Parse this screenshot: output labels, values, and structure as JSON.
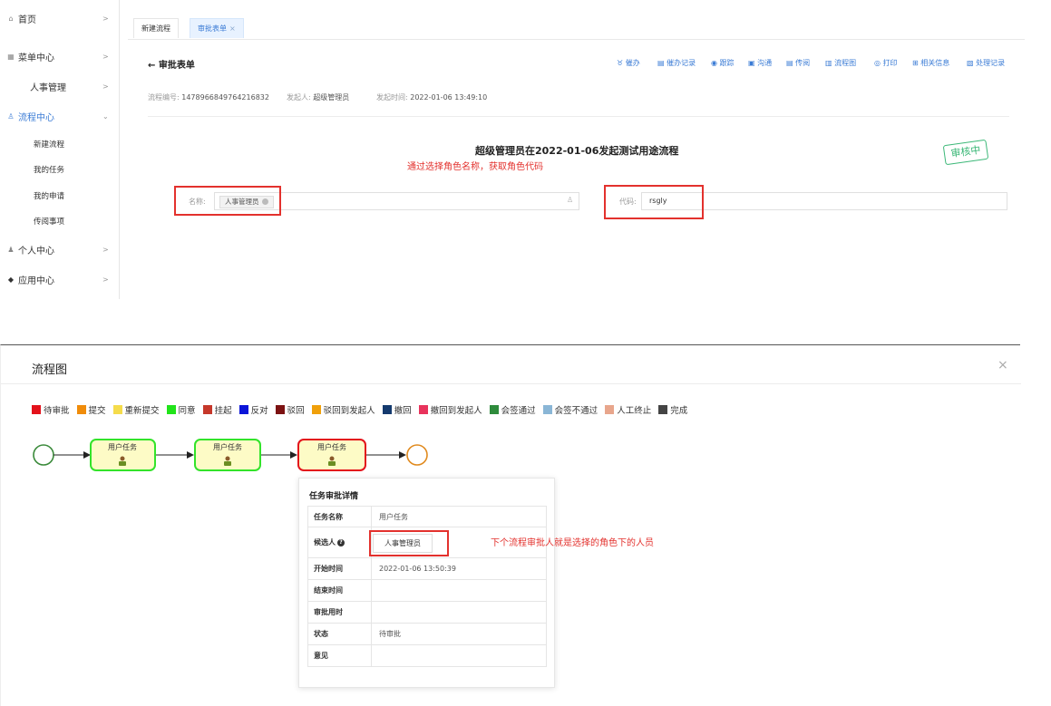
{
  "sidebar": {
    "items": [
      {
        "icon": "home-icon",
        "label": "首页"
      },
      {
        "icon": "grid-icon",
        "label": "菜单中心"
      },
      {
        "label": "人事管理"
      },
      {
        "icon": "flow-icon",
        "label": "流程中心"
      },
      {
        "label": "新建流程"
      },
      {
        "label": "我的任务"
      },
      {
        "label": "我的申请"
      },
      {
        "label": "传阅事项"
      },
      {
        "icon": "user-icon",
        "label": "个人中心"
      },
      {
        "icon": "app-icon",
        "label": "应用中心"
      }
    ],
    "arrow": ">",
    "arrow_down": "⌄"
  },
  "tabs": [
    {
      "label": "新建流程"
    },
    {
      "label": "审批表单",
      "close": "×"
    }
  ],
  "header": {
    "back": "←",
    "title": "审批表单"
  },
  "toolbar": [
    {
      "icon": "urge-icon",
      "label": "催办"
    },
    {
      "icon": "urge-record-icon",
      "label": "催办记录"
    },
    {
      "icon": "track-icon",
      "label": "跟踪"
    },
    {
      "icon": "chat-icon",
      "label": "沟通"
    },
    {
      "icon": "circulate-icon",
      "label": "传阅"
    },
    {
      "icon": "flowchart-icon",
      "label": "流程图"
    },
    {
      "icon": "print-icon",
      "label": "打印"
    },
    {
      "icon": "related-icon",
      "label": "相关信息"
    },
    {
      "icon": "history-icon",
      "label": "处理记录"
    }
  ],
  "meta": {
    "process_no_label": "流程编号:",
    "process_no": "1478966849764216832",
    "initiator_label": "发起人:",
    "initiator": "超级管理员",
    "start_time_label": "发起时间:",
    "start_time": "2022-01-06 13:49:10"
  },
  "form": {
    "title": "超级管理员在2022-01-06发起测试用途流程",
    "note": "通过选择角色名称，获取角色代码",
    "stamp": "审核中",
    "name_label": "名称:",
    "name_value": "人事管理员",
    "code_label": "代码:",
    "code_value": "rsgly"
  },
  "modal": {
    "title": "流程图",
    "close": "×"
  },
  "legend": [
    {
      "label": "待审批",
      "color": "#e3121b"
    },
    {
      "label": "提交",
      "color": "#f08c0a"
    },
    {
      "label": "重新提交",
      "color": "#f5dc4c"
    },
    {
      "label": "同意",
      "color": "#21e41a"
    },
    {
      "label": "挂起",
      "color": "#c6382b"
    },
    {
      "label": "反对",
      "color": "#0b14d8"
    },
    {
      "label": "驳回",
      "color": "#7c1212"
    },
    {
      "label": "驳回到发起人",
      "color": "#f0a00a"
    },
    {
      "label": "撤回",
      "color": "#143a6e"
    },
    {
      "label": "撤回到发起人",
      "color": "#e8335c"
    },
    {
      "label": "会签通过",
      "color": "#2e8b3c"
    },
    {
      "label": "会签不通过",
      "color": "#8ab6d6"
    },
    {
      "label": "人工终止",
      "color": "#e8a68c"
    },
    {
      "label": "完成",
      "color": "#444444"
    }
  ],
  "diagram": {
    "tasks": [
      {
        "label": "用户任务",
        "status": "同意"
      },
      {
        "label": "用户任务",
        "status": "同意"
      },
      {
        "label": "用户任务",
        "status": "待审批"
      }
    ]
  },
  "detail": {
    "title": "任务审批详情",
    "rows": [
      {
        "key": "任务名称",
        "value": "用户任务"
      },
      {
        "key": "候选人",
        "value": ""
      },
      {
        "key": "开始时间",
        "value": "2022-01-06 13:50:39"
      },
      {
        "key": "结束时间",
        "value": ""
      },
      {
        "key": "审批用时",
        "value": ""
      },
      {
        "key": "状态",
        "value": "待审批"
      },
      {
        "key": "意见",
        "value": ""
      }
    ],
    "candidate": "人事管理员",
    "note": "下个流程审批人就是选择的角色下的人员"
  }
}
